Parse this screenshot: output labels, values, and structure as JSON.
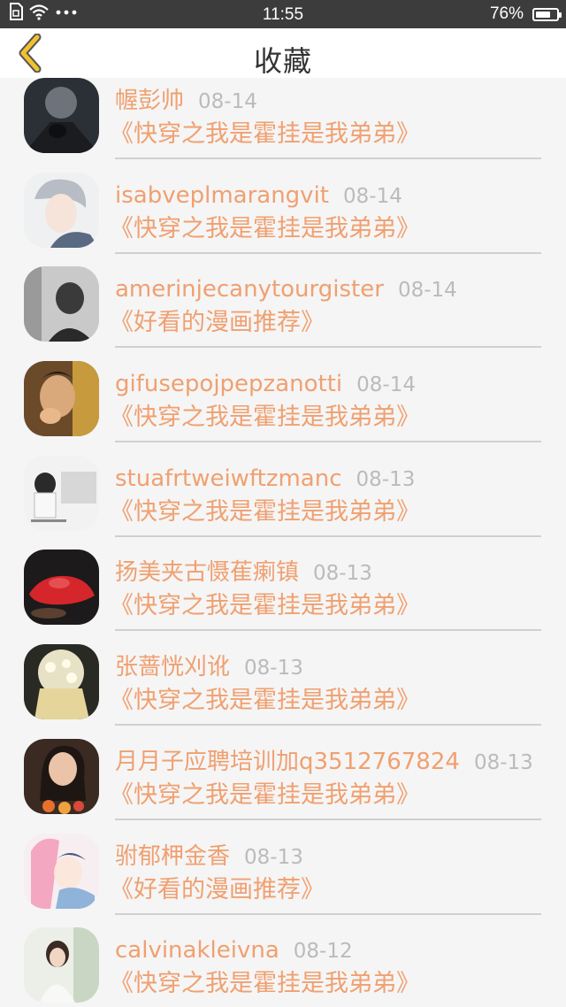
{
  "status_bar": {
    "time": "11:55",
    "battery": "76%",
    "battery_level": 0.76,
    "icons": [
      "sim-icon",
      "wifi-icon",
      "more-dots-icon",
      "battery-icon"
    ]
  },
  "nav": {
    "title": "收藏",
    "back_icon": "chevron-left-icon"
  },
  "colors": {
    "accent": "#f0a070",
    "back_icon": "#f2c12e",
    "status_bar_bg": "#3c3c3c",
    "date": "#bbbbbb",
    "divider": "#d0d0d0"
  },
  "items": [
    {
      "name": "幄彭帅",
      "date": "08-14",
      "title": "《快穿之我是霍挂是我弟弟》"
    },
    {
      "name": "isabveplmarangvit",
      "date": "08-14",
      "title": "《快穿之我是霍挂是我弟弟》"
    },
    {
      "name": "amerinjecanytourgister",
      "date": "08-14",
      "title": "《好看的漫画推荐》"
    },
    {
      "name": "gifusepojpepzanotti",
      "date": "08-14",
      "title": "《快穿之我是霍挂是我弟弟》"
    },
    {
      "name": "stuafrtweiwftzmanc",
      "date": "08-13",
      "title": "《快穿之我是霍挂是我弟弟》"
    },
    {
      "name": "扬美夹古慑萑瘌镇",
      "date": "08-13",
      "title": "《快穿之我是霍挂是我弟弟》"
    },
    {
      "name": "张蔷恍刈讹",
      "date": "08-13",
      "title": "《快穿之我是霍挂是我弟弟》"
    },
    {
      "name": "月月子应聘培训加q3512767824",
      "date": "08-13",
      "title": "《快穿之我是霍挂是我弟弟》"
    },
    {
      "name": "驸郁柙金香",
      "date": "08-13",
      "title": "《好看的漫画推荐》"
    },
    {
      "name": "calvinakleivna",
      "date": "08-12",
      "title": "《快穿之我是霍挂是我弟弟》"
    }
  ]
}
